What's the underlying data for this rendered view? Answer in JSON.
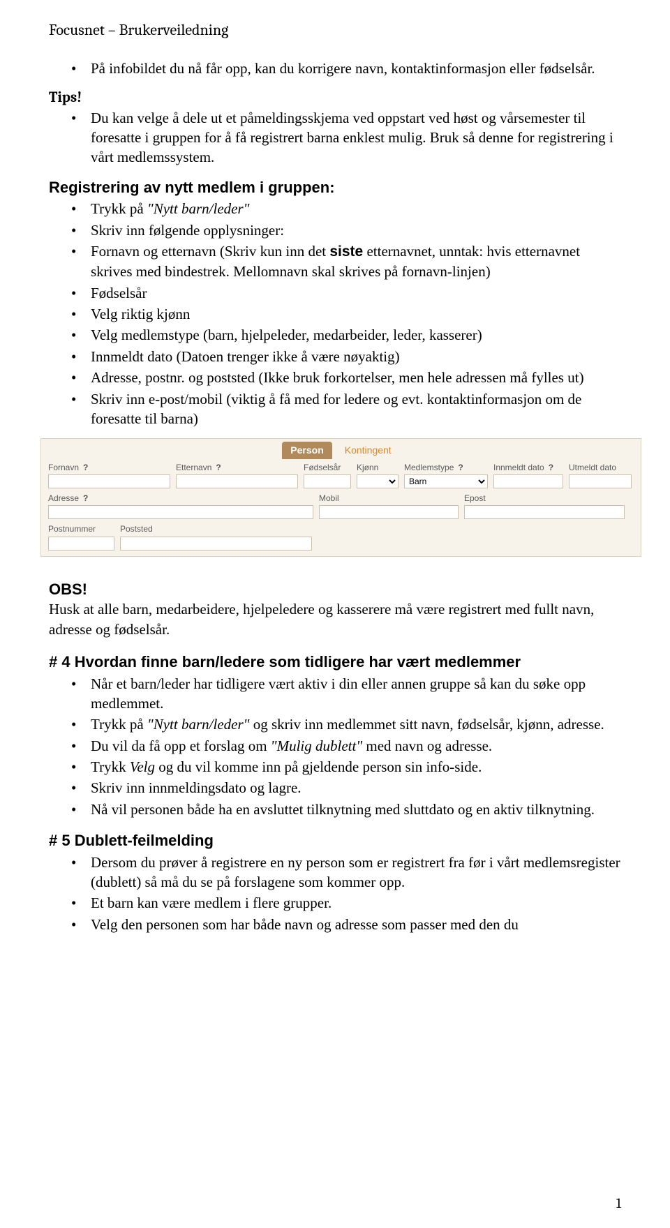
{
  "header": {
    "title": "Focusnet – Brukerveiledning"
  },
  "tips": {
    "label": "Tips!",
    "items": [
      "På infobildet du nå får opp, kan du korrigere navn, kontaktinformasjon eller fødselsår.",
      "Du kan velge å dele ut et påmeldingsskjema ved oppstart ved høst og vårsemester til foresatte i gruppen for å få registrert barna enklest mulig. Bruk så denne for registrering i vårt medlemssystem."
    ]
  },
  "reg": {
    "heading": "Registrering av nytt medlem i gruppen:",
    "items": [
      {
        "pre": "Trykk på ",
        "ital": "\"Nytt barn/leder\"",
        "post": ""
      },
      {
        "text": "Skriv inn følgende opplysninger:"
      },
      {
        "html": "Fornavn og etternavn (Skriv kun inn det <b>siste</b> etternavnet, unntak: hvis etternavnet skrives med bindestrek. Mellomnavn skal skrives på fornavn-linjen)"
      },
      {
        "text": "Fødselsår"
      },
      {
        "text": "Velg riktig kjønn"
      },
      {
        "text": "Velg medlemstype (barn, hjelpeleder, medarbeider, leder, kasserer)"
      },
      {
        "text": "Innmeldt dato (Datoen trenger ikke å være nøyaktig)"
      },
      {
        "text": "Adresse, postnr. og poststed (Ikke bruk forkortelser, men hele adressen må fylles ut)"
      },
      {
        "text": "Skriv inn e-post/mobil (viktig å få med for ledere og evt. kontaktinformasjon om de foresatte til barna)"
      }
    ]
  },
  "form": {
    "tabs": {
      "person": "Person",
      "kontingent": "Kontingent"
    },
    "labels": {
      "fornavn": "Fornavn",
      "etternavn": "Etternavn",
      "fodselsar": "Fødselsår",
      "kjonn": "Kjønn",
      "medlemstype": "Medlemstype",
      "innmeldt": "Innmeldt dato",
      "utmeldt": "Utmeldt dato",
      "adresse": "Adresse",
      "mobil": "Mobil",
      "epost": "Epost",
      "postnummer": "Postnummer",
      "poststed": "Poststed"
    },
    "q": "?",
    "medlemstype_value": "Barn"
  },
  "obs": {
    "heading": "OBS!",
    "text": "Husk at alle barn, medarbeidere, hjelpeledere og kasserere må være registrert med fullt navn, adresse og fødselsår."
  },
  "s4": {
    "heading": "# 4 Hvordan finne barn/ledere som tidligere har vært medlemmer",
    "items": [
      "Når et barn/leder har tidligere vært aktiv i din eller annen gruppe så kan du søke opp medlemmet.",
      {
        "pre": "Trykk på ",
        "ital": "\"Nytt barn/leder\"",
        "post": " og skriv inn medlemmet sitt navn, fødselsår, kjønn, adresse."
      },
      {
        "pre": "Du vil da få opp et forslag om ",
        "ital": "\"Mulig dublett\"",
        "post": " med navn og adresse."
      },
      {
        "pre": "Trykk ",
        "ital": "Velg",
        "post": " og du vil komme inn på gjeldende person sin info-side."
      },
      "Skriv inn innmeldingsdato og lagre.",
      "Nå vil personen både ha en avsluttet tilknytning med sluttdato og en aktiv tilknytning."
    ]
  },
  "s5": {
    "heading": "# 5 Dublett-feilmelding",
    "items": [
      "Dersom du prøver å registrere en ny person som er registrert fra før i vårt medlemsregister (dublett) så må du se på forslagene som kommer opp.",
      "Et barn kan være medlem i flere grupper.",
      "Velg den personen som har både navn og adresse som passer med den du"
    ]
  },
  "page_number": "1"
}
